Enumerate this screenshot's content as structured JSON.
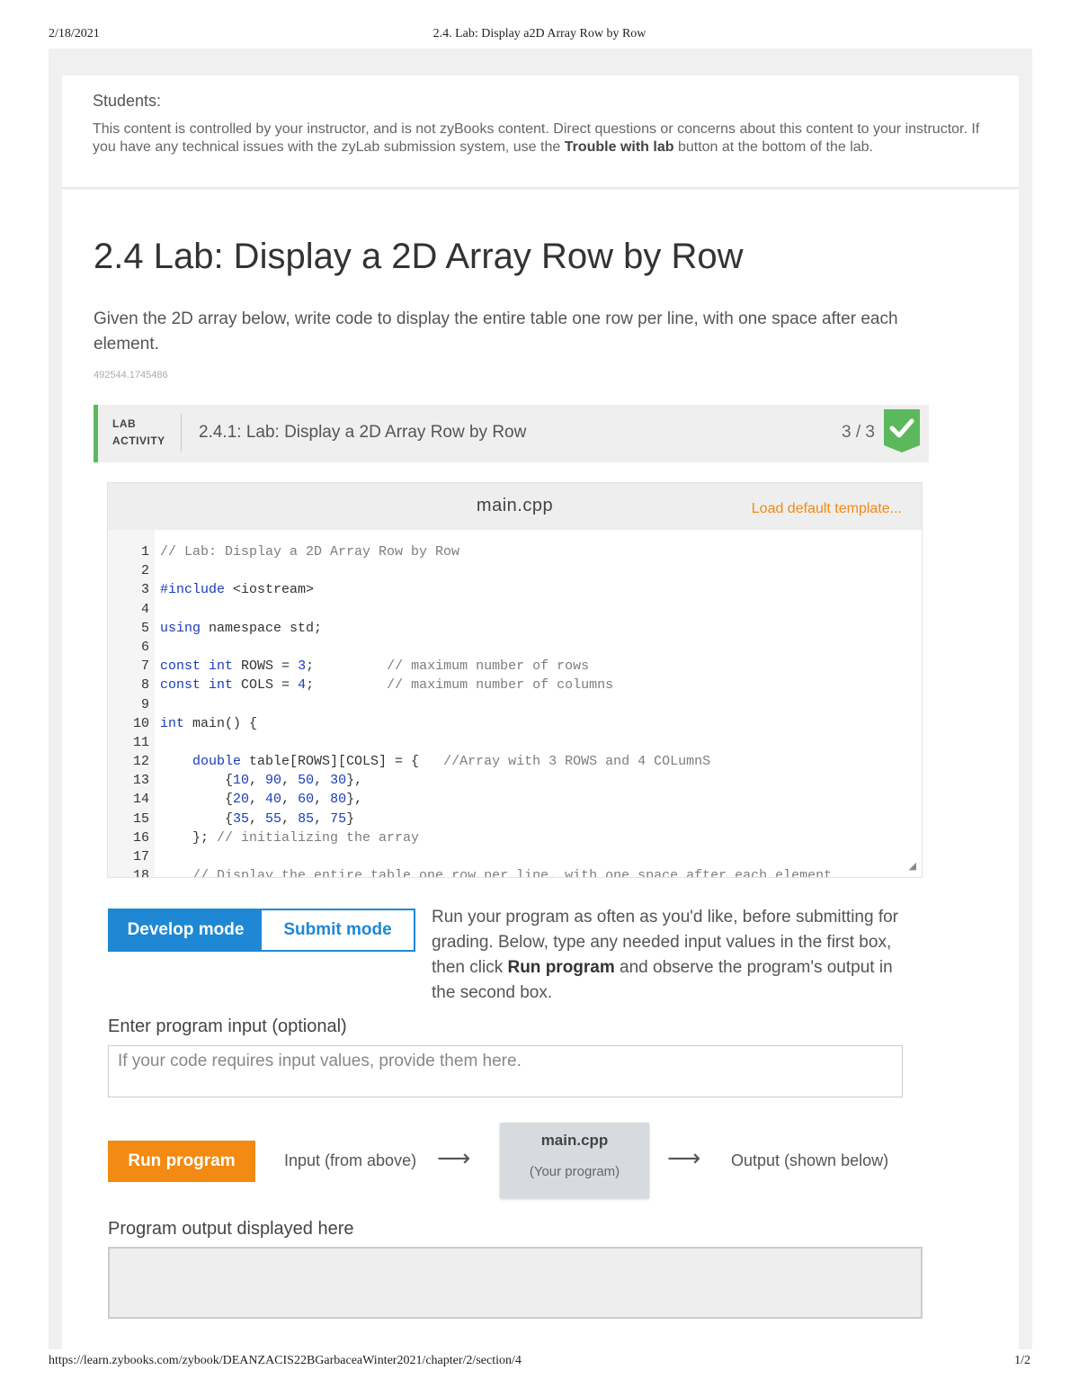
{
  "print": {
    "date": "2/18/2021",
    "title": "2.4. Lab: Display a2D Array Row by Row",
    "url": "https://learn.zybooks.com/zybook/DEANZACIS22BGarbaceaWinter2021/chapter/2/section/4",
    "page": "1/2"
  },
  "notice": {
    "heading": "Students:",
    "text_before": "This content is controlled by your instructor, and is not zyBooks content. Direct questions or concerns about this content to your instructor. If you have any technical issues with the zyLab submission system, use the ",
    "bold": "Trouble with lab",
    "text_after": " button at the bottom of the lab."
  },
  "section": {
    "title": "2.4 Lab: Display a 2D Array Row by Row",
    "description": "Given the 2D array below, write code to display the entire table one row per line, with one space after each element.",
    "meta": "492544.1745486"
  },
  "lab": {
    "label_line1": "LAB",
    "label_line2": "ACTIVITY",
    "title": "2.4.1: Lab: Display a 2D Array Row by Row",
    "score": "3 / 3",
    "check_icon": "checkmark-icon",
    "accent_color": "#5cb85c"
  },
  "editor": {
    "filename": "main.cpp",
    "load_template": "Load default template...",
    "lines": [
      {
        "n": "1",
        "segs": [
          {
            "t": "// Lab: Display a 2D Array Row by Row",
            "c": "com"
          }
        ]
      },
      {
        "n": "2",
        "segs": []
      },
      {
        "n": "3",
        "segs": [
          {
            "t": "#include",
            "c": "kw"
          },
          {
            "t": " <iostream>",
            "c": ""
          }
        ]
      },
      {
        "n": "4",
        "segs": []
      },
      {
        "n": "5",
        "segs": [
          {
            "t": "using",
            "c": "kw"
          },
          {
            "t": " namespace std;",
            "c": ""
          }
        ]
      },
      {
        "n": "6",
        "segs": []
      },
      {
        "n": "7",
        "segs": [
          {
            "t": "const",
            "c": "kw"
          },
          {
            "t": " ",
            "c": ""
          },
          {
            "t": "int",
            "c": "kw"
          },
          {
            "t": " ROWS = ",
            "c": ""
          },
          {
            "t": "3",
            "c": "num"
          },
          {
            "t": ";         ",
            "c": ""
          },
          {
            "t": "// maximum number of rows",
            "c": "com"
          }
        ]
      },
      {
        "n": "8",
        "segs": [
          {
            "t": "const",
            "c": "kw"
          },
          {
            "t": " ",
            "c": ""
          },
          {
            "t": "int",
            "c": "kw"
          },
          {
            "t": " COLS = ",
            "c": ""
          },
          {
            "t": "4",
            "c": "num"
          },
          {
            "t": ";         ",
            "c": ""
          },
          {
            "t": "// maximum number of columns",
            "c": "com"
          }
        ]
      },
      {
        "n": "9",
        "segs": []
      },
      {
        "n": "10",
        "segs": [
          {
            "t": "int",
            "c": "kw"
          },
          {
            "t": " main() {",
            "c": ""
          }
        ]
      },
      {
        "n": "11",
        "segs": []
      },
      {
        "n": "12",
        "segs": [
          {
            "t": "    ",
            "c": ""
          },
          {
            "t": "double",
            "c": "kw"
          },
          {
            "t": " table[ROWS][COLS] = {   ",
            "c": ""
          },
          {
            "t": "//Array with 3 ROWS and 4 COLumnS",
            "c": "com"
          }
        ]
      },
      {
        "n": "13",
        "segs": [
          {
            "t": "        {",
            "c": ""
          },
          {
            "t": "10",
            "c": "num"
          },
          {
            "t": ", ",
            "c": ""
          },
          {
            "t": "90",
            "c": "num"
          },
          {
            "t": ", ",
            "c": ""
          },
          {
            "t": "50",
            "c": "num"
          },
          {
            "t": ", ",
            "c": ""
          },
          {
            "t": "30",
            "c": "num"
          },
          {
            "t": "},",
            "c": ""
          }
        ]
      },
      {
        "n": "14",
        "segs": [
          {
            "t": "        {",
            "c": ""
          },
          {
            "t": "20",
            "c": "num"
          },
          {
            "t": ", ",
            "c": ""
          },
          {
            "t": "40",
            "c": "num"
          },
          {
            "t": ", ",
            "c": ""
          },
          {
            "t": "60",
            "c": "num"
          },
          {
            "t": ", ",
            "c": ""
          },
          {
            "t": "80",
            "c": "num"
          },
          {
            "t": "},",
            "c": ""
          }
        ]
      },
      {
        "n": "15",
        "segs": [
          {
            "t": "        {",
            "c": ""
          },
          {
            "t": "35",
            "c": "num"
          },
          {
            "t": ", ",
            "c": ""
          },
          {
            "t": "55",
            "c": "num"
          },
          {
            "t": ", ",
            "c": ""
          },
          {
            "t": "85",
            "c": "num"
          },
          {
            "t": ", ",
            "c": ""
          },
          {
            "t": "75",
            "c": "num"
          },
          {
            "t": "}",
            "c": ""
          }
        ]
      },
      {
        "n": "16",
        "segs": [
          {
            "t": "    }; ",
            "c": ""
          },
          {
            "t": "// initializing the array",
            "c": "com"
          }
        ]
      },
      {
        "n": "17",
        "segs": []
      },
      {
        "n": "18",
        "segs": [
          {
            "t": "    ",
            "c": ""
          },
          {
            "t": "// Display the entire table one row per line, with one space after each element",
            "c": "com"
          }
        ]
      }
    ]
  },
  "modes": {
    "develop": "Develop mode",
    "submit": "Submit mode",
    "desc_before": "Run your program as often as you'd like, before submitting for grading. Below, type any needed input values in the first box, then click ",
    "desc_bold": "Run program",
    "desc_after": " and observe the program's output in the second box."
  },
  "input": {
    "label": "Enter program input (optional)",
    "placeholder": "If your code requires input values, provide them here.",
    "value": ""
  },
  "run": {
    "button": "Run program",
    "input_from": "Input (from above)",
    "program_name": "main.cpp",
    "program_sub": "(Your program)",
    "output_to": "Output (shown below)"
  },
  "output": {
    "label": "Program output displayed here",
    "value": ""
  },
  "colors": {
    "accent_blue": "#1e88d4",
    "accent_orange": "#f28a13",
    "success_green": "#5cb85c"
  }
}
